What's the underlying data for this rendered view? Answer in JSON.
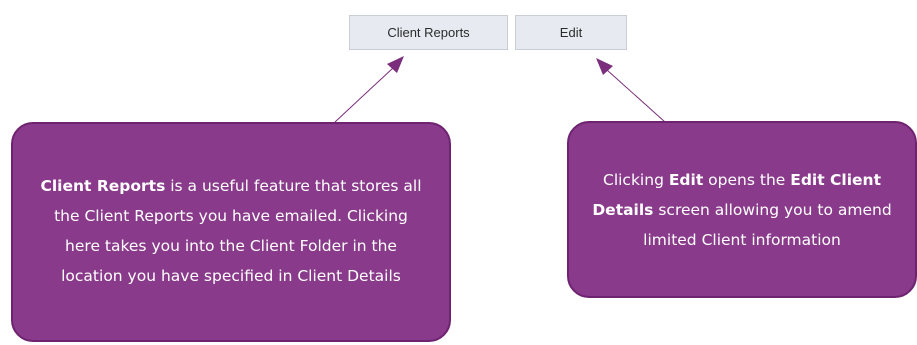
{
  "toolbar": {
    "client_reports_label": "Client Reports",
    "edit_label": "Edit"
  },
  "callouts": {
    "client_reports": {
      "bold_title": "Client Reports",
      "text_1": " is a useful feature that stores all the Client Reports you have emailed. Clicking here takes you into the Client Folder in the location you have specified in Client Details"
    },
    "edit": {
      "text_1": "Clicking ",
      "bold_1": "Edit",
      "text_2": " opens the ",
      "bold_2": "Edit Client Details",
      "text_3": " screen allowing you to amend limited Client information"
    }
  },
  "colors": {
    "callout_fill": "#8a3a8b",
    "callout_border": "#6e2370",
    "button_fill": "#e7ebf1",
    "arrow": "#7a2e7c"
  }
}
